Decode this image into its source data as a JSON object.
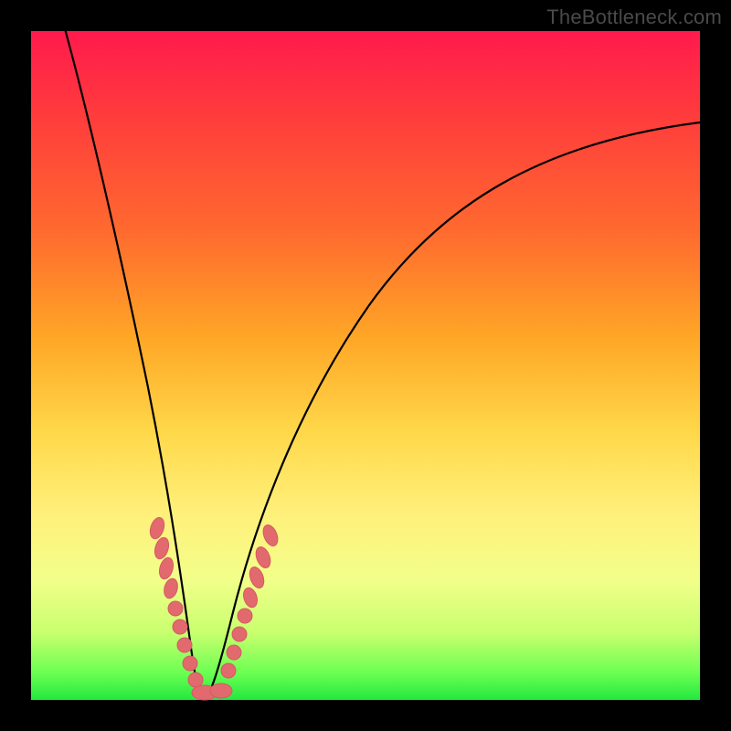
{
  "watermark": "TheBottleneck.com",
  "colors": {
    "frame": "#000000",
    "gradient_top": "#ff1a4d",
    "gradient_bottom": "#23e83e",
    "curve": "#000000",
    "dots": "#e26a6f"
  },
  "chart_data": {
    "type": "line",
    "title": "",
    "xlabel": "",
    "ylabel": "",
    "xlim": [
      0,
      100
    ],
    "ylim": [
      0,
      100
    ],
    "note": "No axis ticks or labels visible; values are pixel-relative estimates of a bottleneck-style V curve. y is plotted with 0 at bottom.",
    "series": [
      {
        "name": "bottleneck-curve",
        "x": [
          5,
          8,
          12,
          15,
          18,
          20,
          22,
          23.5,
          25,
          27,
          30,
          35,
          40,
          50,
          60,
          70,
          80,
          90,
          100
        ],
        "y": [
          100,
          87,
          70,
          55,
          40,
          27,
          14,
          4,
          0,
          4,
          14,
          28,
          40,
          57,
          68,
          76,
          81,
          84,
          86
        ]
      }
    ],
    "highlight_points": {
      "description": "Pink marker dots clustered along the lower V region of the curve",
      "points_x": [
        18.5,
        19.5,
        20.2,
        21,
        21.8,
        22.5,
        23.2,
        24,
        25,
        26,
        26.8,
        27.5,
        28.3,
        29,
        29.8,
        30.5
      ],
      "points_y": [
        24,
        20,
        17,
        14,
        10,
        7,
        4,
        1,
        0,
        1,
        4,
        7,
        10,
        13,
        16,
        20
      ]
    }
  }
}
